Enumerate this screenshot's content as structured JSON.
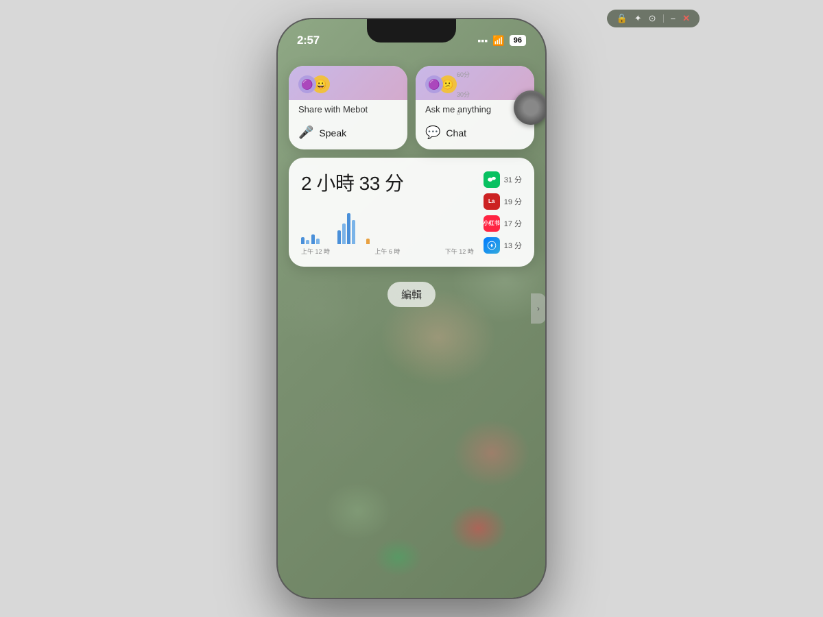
{
  "window": {
    "chrome_icons": [
      "🔒",
      "✦",
      "⊙",
      "−",
      "✕"
    ]
  },
  "phone": {
    "status_bar": {
      "time": "2:57",
      "battery": "96"
    },
    "widget1": {
      "title": "Share with Mebot",
      "action_label": "Speak",
      "action_icon": "🎤"
    },
    "widget2": {
      "title": "Ask me anything",
      "action_label": "Chat",
      "action_icon": "💬"
    },
    "screen_time": {
      "total": "2 小時 33 分",
      "apps": [
        {
          "name": "WeChat",
          "minutes": "31 分",
          "color": "wechat-green",
          "symbol": "✓"
        },
        {
          "name": "LALA",
          "minutes": "19 分",
          "color": "lala-red",
          "symbol": "La"
        },
        {
          "name": "Xiaohongshu",
          "minutes": "17 分",
          "color": "xiaohongshu",
          "symbol": "小"
        },
        {
          "name": "Safari",
          "minutes": "13 分",
          "color": "safari-blue",
          "symbol": "⊙"
        }
      ],
      "chart_labels": [
        "上午 12 時",
        "上午 6 時",
        "下午 12 時"
      ],
      "y_labels": [
        "60分",
        "30分",
        "0"
      ]
    },
    "edit_button": "編輯"
  }
}
